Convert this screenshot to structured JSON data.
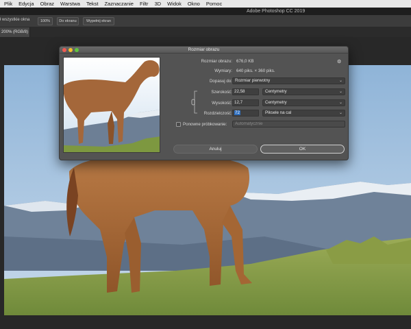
{
  "menubar": {
    "items": [
      "Plik",
      "Edycja",
      "Obraz",
      "Warstwa",
      "Tekst",
      "Zaznaczanie",
      "Filtr",
      "3D",
      "Widok",
      "Okno",
      "Pomoc"
    ]
  },
  "app": {
    "title": "Adobe Photoshop CC 2019"
  },
  "options_bar": {
    "scroll_all_label": "ł wszystkie okna",
    "buttons": [
      "100%",
      "Do ekranu",
      "Wypełnij ekran"
    ]
  },
  "document": {
    "tab_label": "200% (RGB/8)"
  },
  "dialog": {
    "title": "Rozmiar obrazu",
    "image_size_label": "Rozmiar obrazu:",
    "image_size_value": "676,0 KB",
    "dimensions_label": "Wymiary:",
    "dimensions_value": "640 piks. × 360 piks.",
    "fit_to_label": "Dopasuj do:",
    "fit_to_value": "Rozmiar pierwotny",
    "width_label": "Szerokość:",
    "width_value": "22,58",
    "width_unit": "Centymetry",
    "height_label": "Wysokość:",
    "height_value": "12,7",
    "height_unit": "Centymetry",
    "resolution_label": "Rozdzielczość:",
    "resolution_value": "72",
    "resolution_unit": "Piksele na cal",
    "resample_label": "Ponowne próbkowanie:",
    "resample_value": "Automatycznie",
    "resample_checked": false,
    "cancel_label": "Anuluj",
    "ok_label": "OK"
  },
  "colors": {
    "selection": "#2f6fbf",
    "dialog_bg": "#535353",
    "workspace": "#282828"
  },
  "icons": [
    "gear-icon",
    "chain-link-icon",
    "chevron-down-icon"
  ]
}
